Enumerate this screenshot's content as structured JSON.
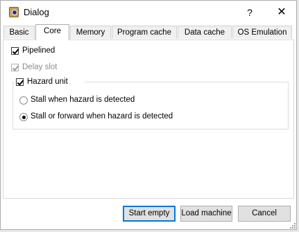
{
  "window": {
    "title": "Dialog",
    "help_glyph": "?",
    "close_glyph": "✕",
    "app_icon": "dialog-app-icon"
  },
  "tabs": [
    {
      "label": "Basic",
      "active": false
    },
    {
      "label": "Core",
      "active": true
    },
    {
      "label": "Memory",
      "active": false
    },
    {
      "label": "Program cache",
      "active": false
    },
    {
      "label": "Data cache",
      "active": false
    },
    {
      "label": "OS Emulation",
      "active": false
    }
  ],
  "core": {
    "pipelined": {
      "label": "Pipelined",
      "checked": true,
      "enabled": true
    },
    "delay_slot": {
      "label": "Delay slot",
      "checked": true,
      "enabled": false
    },
    "hazard_unit": {
      "label": "Hazard unit",
      "checked": true,
      "options": [
        {
          "label": "Stall when hazard is detected",
          "selected": false
        },
        {
          "label": "Stall or forward when hazard is detected",
          "selected": true
        }
      ]
    }
  },
  "buttons": {
    "start_empty": "Start empty",
    "load_machine": "Load machine",
    "cancel": "Cancel"
  },
  "colors": {
    "focus_accent": "#0078d7",
    "button_face": "#e1e1e1",
    "disabled_text": "#8c8c8c"
  }
}
